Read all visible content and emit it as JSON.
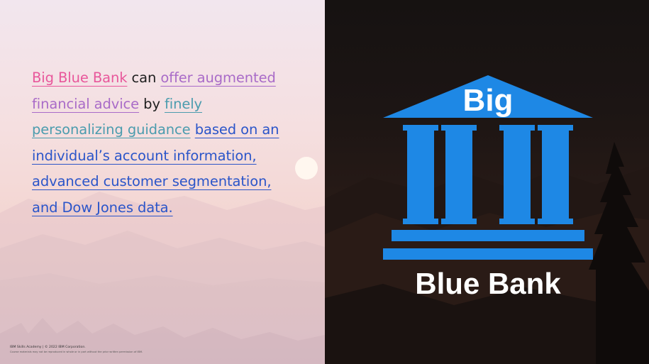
{
  "slide": {
    "paragraph": {
      "segments": [
        {
          "text": "Big Blue Bank",
          "style": "pink"
        },
        {
          "text": " can ",
          "style": "plain"
        },
        {
          "text": "offer augmented financial advice",
          "style": "purple"
        },
        {
          "text": " by ",
          "style": "plain"
        },
        {
          "text": "finely personalizing guidance",
          "style": "teal"
        },
        {
          "text": " ",
          "style": "plain"
        },
        {
          "text": "based on an individual’s account information, advanced customer segmentation, and Dow Jones data.",
          "style": "blue"
        }
      ]
    },
    "logo": {
      "top_word": "Big",
      "bottom_words": "Blue Bank",
      "icon": "bank-building-icon",
      "color": "#1e88e5"
    },
    "footer": {
      "line1": "IBM Skills Academy | © 2022 IBM Corporation.",
      "line2": "Course materials may not be reproduced in whole or in part without the prior written permission of IBM."
    }
  },
  "colors": {
    "pink": "#e8579b",
    "purple": "#a96bc8",
    "teal": "#4b9cae",
    "blue": "#2b55c9",
    "logo_blue": "#1e88e5"
  }
}
